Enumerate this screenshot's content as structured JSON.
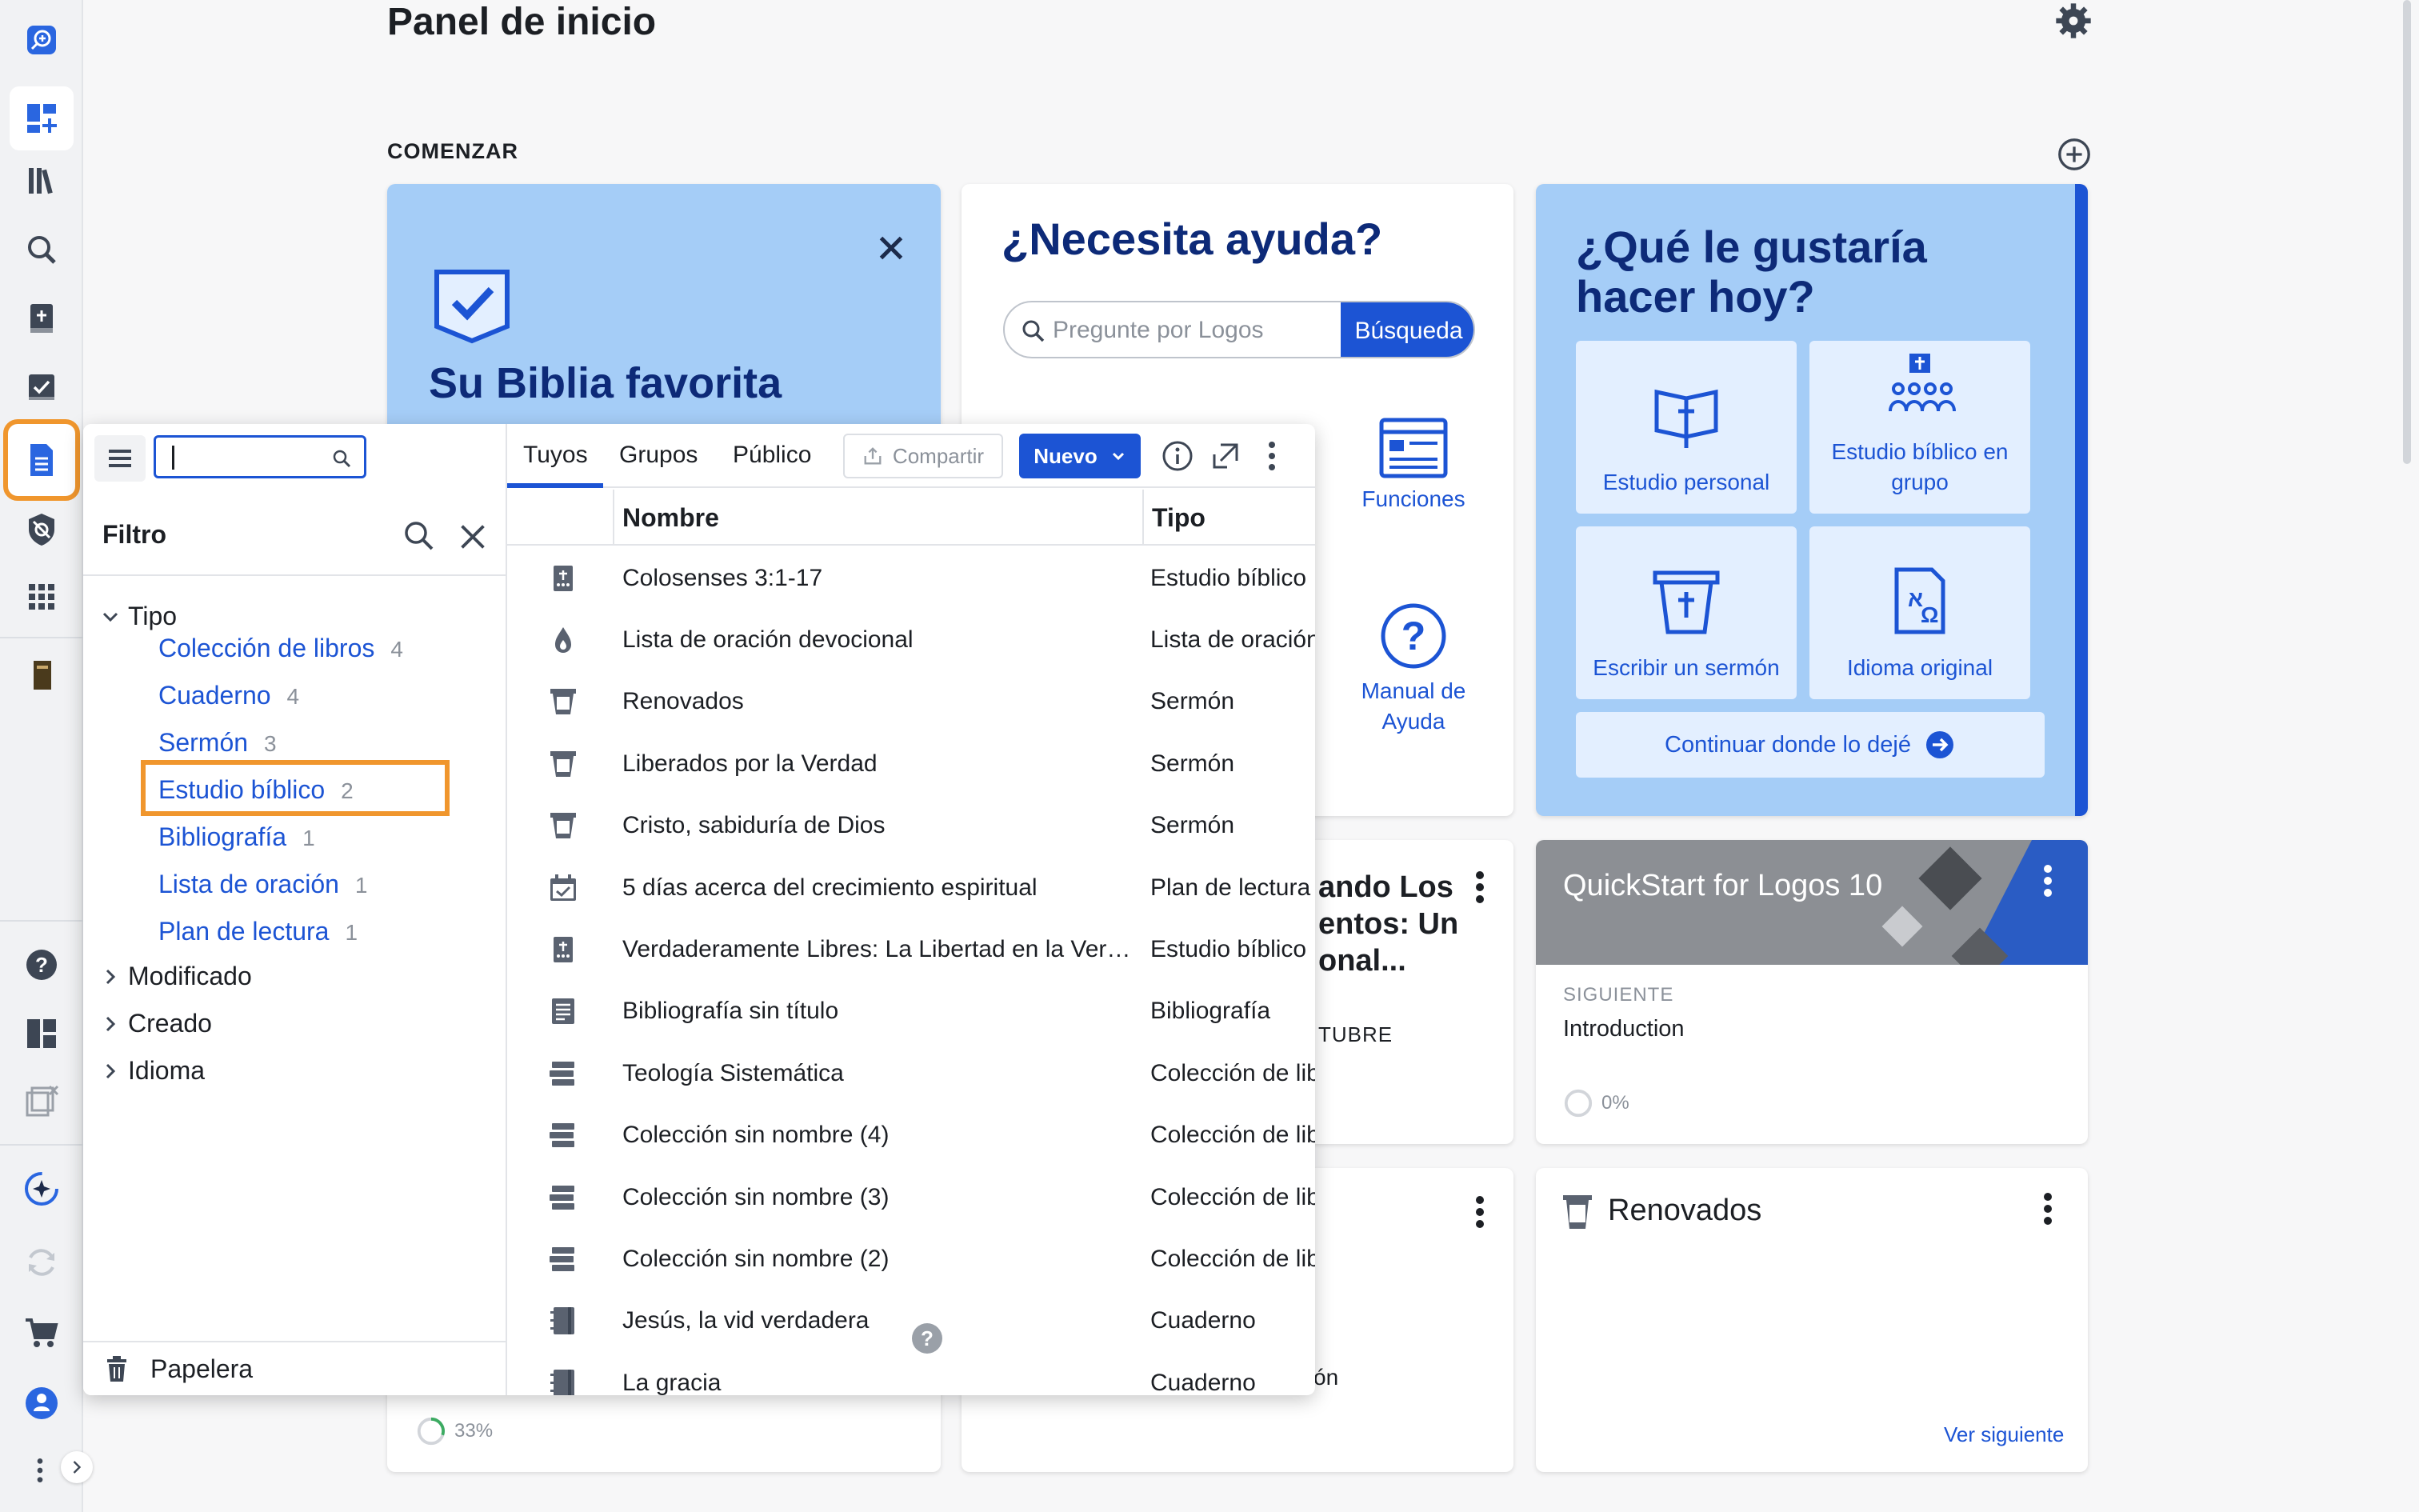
{
  "page": {
    "title": "Panel de inicio",
    "section_label": "COMENZAR"
  },
  "colors": {
    "brand_blue": "#1c54d4",
    "dark_blue": "#0d2a78",
    "light_blue": "#a5cdf7",
    "highlight_orange": "#f0962d"
  },
  "rail": {
    "items": [
      "search-books-icon",
      "dashboard-icon",
      "library-icon",
      "search-icon",
      "bible-add-icon",
      "checklist-icon",
      "documents-icon",
      "shield-icon",
      "apps-grid-icon",
      "book-icon",
      "help-icon",
      "layout-icon",
      "clipboard-close-icon",
      "ai-sparkle-icon",
      "sync-icon",
      "cart-icon",
      "user-icon",
      "more-icon",
      "expand-icon"
    ]
  },
  "bible_card": {
    "title": "Su Biblia favorita",
    "progress": "33%"
  },
  "help_card": {
    "title": "¿Necesita ayuda?",
    "search_placeholder": "Pregunte por Logos",
    "search_button": "Búsqueda",
    "funciones": "Funciones",
    "manual": "Manual de Ayuda"
  },
  "what_card": {
    "title": "¿Qué le gustaría hacer hoy?",
    "tiles": [
      {
        "label": "Estudio personal",
        "icon": "bible-cross-icon"
      },
      {
        "label": "Estudio bíblico en grupo",
        "icon": "group-study-icon"
      },
      {
        "label": "Escribir un sermón",
        "icon": "pulpit-icon"
      },
      {
        "label": "Idioma original",
        "icon": "original-language-icon"
      }
    ],
    "continue": "Continuar donde lo dejé"
  },
  "prayer_card": {
    "title_lines": [
      "ando Los",
      "entos: Un",
      "onal..."
    ],
    "month": "TUBRE"
  },
  "bottom_mid_card": {
    "text": "ón"
  },
  "quick_card": {
    "title": "QuickStart for Logos 10",
    "next_label": "SIGUIENTE",
    "next": "Introduction",
    "progress": "0%"
  },
  "renov_card": {
    "title": "Renovados",
    "next_link": "Ver siguiente"
  },
  "docs_panel": {
    "search_value": "",
    "tabs": [
      "Tuyos",
      "Grupos",
      "Público"
    ],
    "share": "Compartir",
    "new": "Nuevo",
    "filter": {
      "label": "Filtro",
      "tipo": "Tipo",
      "types": [
        {
          "label": "Colección de libros",
          "count": "4"
        },
        {
          "label": "Cuaderno",
          "count": "4"
        },
        {
          "label": "Sermón",
          "count": "3"
        },
        {
          "label": "Estudio bíblico",
          "count": "2"
        },
        {
          "label": "Bibliografía",
          "count": "1"
        },
        {
          "label": "Lista de oración",
          "count": "1"
        },
        {
          "label": "Plan de lectura",
          "count": "1"
        }
      ],
      "groups": [
        "Modificado",
        "Creado",
        "Idioma"
      ],
      "trash": "Papelera"
    },
    "columns": {
      "name": "Nombre",
      "type": "Tipo"
    },
    "rows": [
      {
        "name": "Colosenses 3:1-17",
        "type": "Estudio bíblico",
        "icon": "bible-study-icon"
      },
      {
        "name": "Lista de oración devocional",
        "type": "Lista de oración",
        "icon": "prayer-icon"
      },
      {
        "name": "Renovados",
        "type": "Sermón",
        "icon": "sermon-icon"
      },
      {
        "name": "Liberados por la Verdad",
        "type": "Sermón",
        "icon": "sermon-icon"
      },
      {
        "name": "Cristo, sabiduría de Dios",
        "type": "Sermón",
        "icon": "sermon-icon"
      },
      {
        "name": "5 días acerca del crecimiento espiritual",
        "type": "Plan de lectura",
        "icon": "calendar-icon"
      },
      {
        "name": "Verdaderamente Libres: La Libertad en la Verd…",
        "type": "Estudio bíblico",
        "icon": "bible-study-icon"
      },
      {
        "name": "Bibliografía sin título",
        "type": "Bibliografía",
        "icon": "bibliography-icon"
      },
      {
        "name": "Teología Sistemática",
        "type": "Colección de lib",
        "icon": "collection-icon"
      },
      {
        "name": "Colección sin nombre (4)",
        "type": "Colección de lib",
        "icon": "collection-icon"
      },
      {
        "name": "Colección sin nombre (3)",
        "type": "Colección de lib",
        "icon": "collection-icon"
      },
      {
        "name": "Colección sin nombre (2)",
        "type": "Colección de lib",
        "icon": "collection-icon"
      },
      {
        "name": "Jesús, la vid verdadera",
        "type": "Cuaderno",
        "icon": "notebook-icon"
      },
      {
        "name": "La gracia",
        "type": "Cuaderno",
        "icon": "notebook-icon"
      }
    ]
  }
}
